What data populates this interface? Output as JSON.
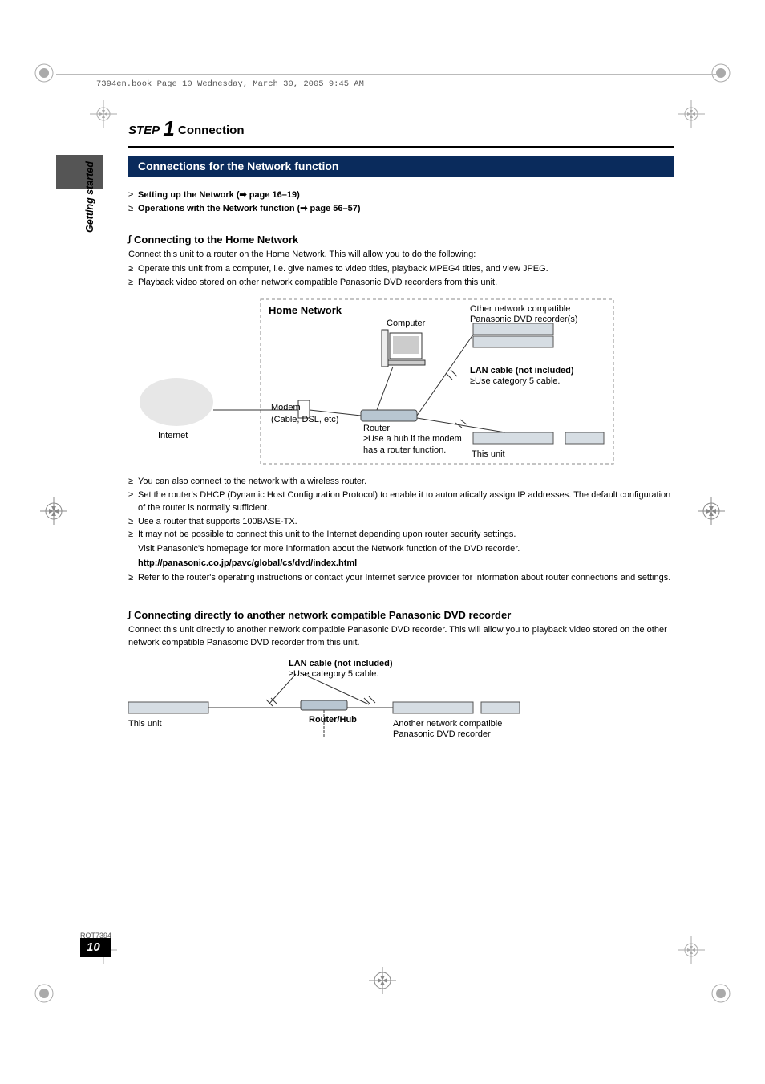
{
  "meta": {
    "header": "7394en.book  Page 10  Wednesday, March 30, 2005  9:45 AM",
    "doc_code": "RQT7394",
    "page_number": "10",
    "side_tab": "Getting started"
  },
  "title": {
    "step_word": "STEP",
    "step_num": "1",
    "rest": " Connection"
  },
  "section_bar": "Connections for the Network function",
  "refs": {
    "r1": "Setting up the Network (➡ page 16–19)",
    "r2": "Operations with the Network function (➡ page 56–57)"
  },
  "home_network": {
    "heading": "Connecting to the Home Network",
    "intro": "Connect this unit to a router on the Home Network. This will allow you to do the following:",
    "b1": "Operate this unit from a computer, i.e. give names to video titles, playback MPEG4 titles, and view JPEG.",
    "b2": "Playback video stored on other network compatible Panasonic DVD recorders from this unit.",
    "diagram": {
      "title": "Home Network",
      "internet": "Internet",
      "modem1": "Modem",
      "modem2": "(Cable, DSL, etc)",
      "computer": "Computer",
      "router": "Router",
      "router_note": "Use a hub if the modem has a router function.",
      "other1": "Other network compatible",
      "other2": "Panasonic DVD recorder(s)",
      "lan_title": "LAN cable (not included)",
      "lan_note": "Use category 5 cable.",
      "this_unit": "This unit"
    },
    "notes": {
      "n1": "You can also connect to the network with a wireless router.",
      "n2": "Set the router's DHCP (Dynamic Host Configuration Protocol) to enable it to automatically assign IP addresses. The default configuration of the router is normally sufficient.",
      "n3": "Use a router that supports 100BASE-TX.",
      "n4": "It may not be possible to connect this unit to the Internet depending upon router security settings.",
      "n5": "Visit Panasonic's homepage for more information about the Network function of the DVD recorder.",
      "url": "http://panasonic.co.jp/pavc/global/cs/dvd/index.html",
      "n6": "Refer to the router's operating instructions or contact your Internet service provider for information about router connections and settings."
    }
  },
  "direct": {
    "heading": "Connecting directly to another network compatible Panasonic DVD recorder",
    "intro": "Connect this unit directly to another network compatible Panasonic DVD recorder. This will allow you to playback video stored on the other network compatible Panasonic DVD recorder from this unit.",
    "diagram": {
      "lan_title": "LAN cable (not included)",
      "lan_note": "Use category 5 cable.",
      "this_unit": "This unit",
      "router_hub": "Router/Hub",
      "other1": "Another network compatible",
      "other2": "Panasonic DVD recorder"
    }
  }
}
